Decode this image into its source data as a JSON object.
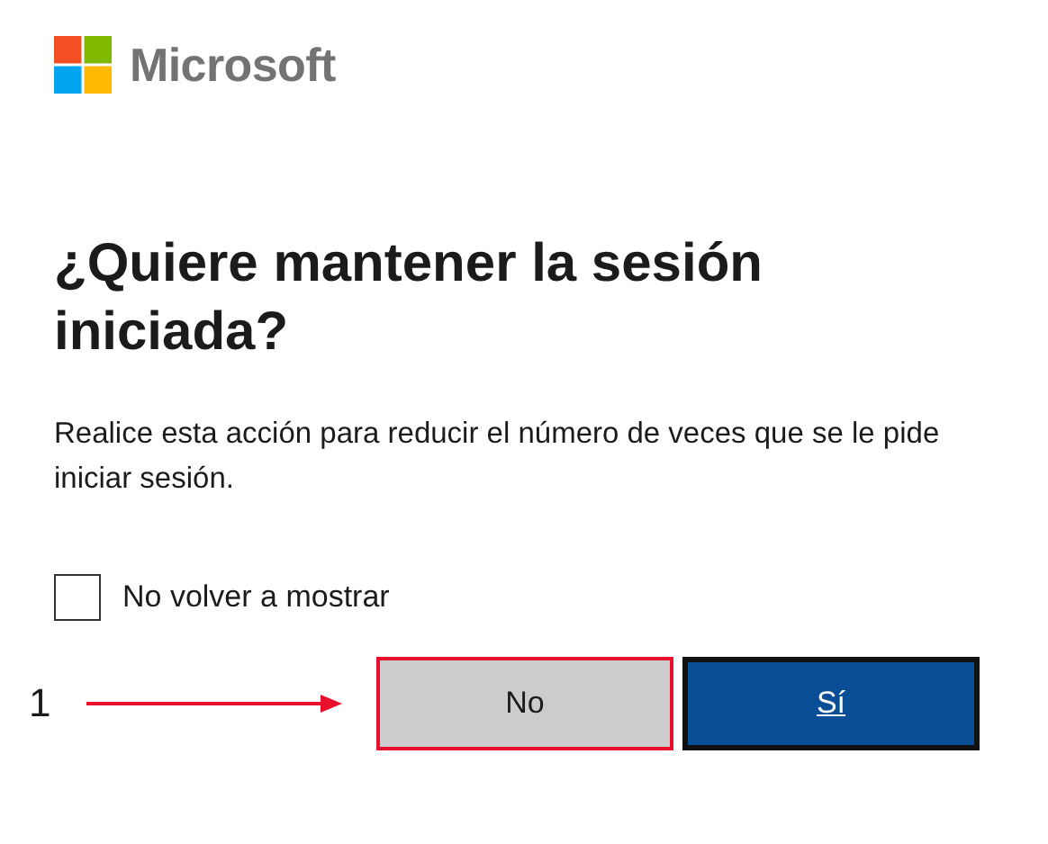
{
  "logo": {
    "text": "Microsoft"
  },
  "heading": "¿Quiere mantener la sesión iniciada?",
  "description": "Realice esta acción para reducir el número de veces que se le pide iniciar sesión.",
  "checkbox": {
    "label": "No volver a mostrar",
    "checked": false
  },
  "annotation": {
    "label": "1"
  },
  "buttons": [
    {
      "label": "No",
      "kind": "secondary",
      "highlighted": true
    },
    {
      "label": "Sí",
      "kind": "primary",
      "highlighted": false
    }
  ]
}
